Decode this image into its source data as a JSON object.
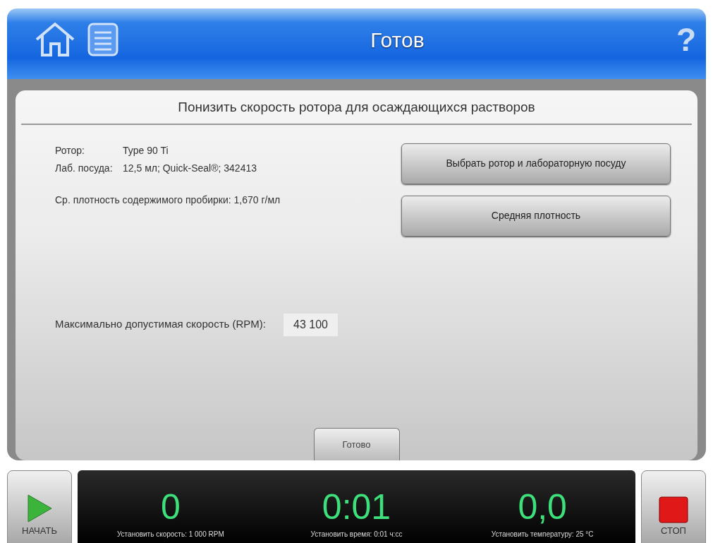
{
  "header": {
    "title": "Готов",
    "help": "?"
  },
  "panel": {
    "title": "Понизить скорость ротора для осаждающихся растворов",
    "info": [
      {
        "label": "Ротор:",
        "value": "Type 90 Ti"
      },
      {
        "label": "Лаб. посуда:",
        "value": "12,5 мл; Quick-Seal®; 342413"
      }
    ],
    "density": "Ср. плотность содержимого пробирки: 1,670 г/мл",
    "buttons": [
      "Выбрать ротор и лабораторную посуду",
      "Средняя плотность"
    ],
    "max_speed": {
      "label": "Максимально допустимая скорость (RPM):",
      "value": "43 100"
    },
    "done": "Готово"
  },
  "footer": {
    "start": "НАЧАТЬ",
    "stop": "СТОП",
    "readouts": [
      {
        "value": "0",
        "caption": "Установить скорость: 1 000 RPM"
      },
      {
        "value": "0:01",
        "caption": "Установить время: 0:01 ч:сс"
      },
      {
        "value": "0,0",
        "caption": "Установить температуру: 25 °C"
      }
    ]
  }
}
